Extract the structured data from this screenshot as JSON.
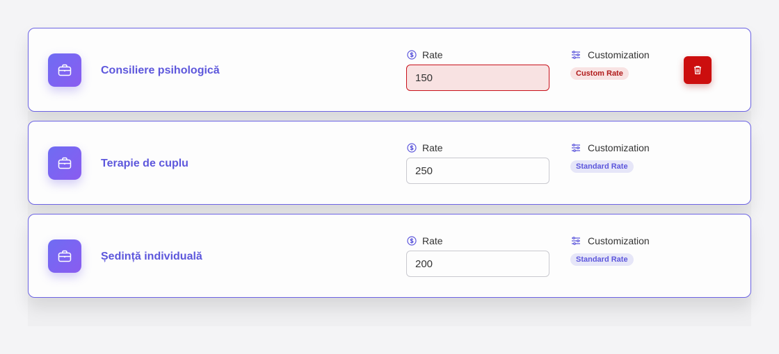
{
  "rate_label": "Rate",
  "customization_label": "Customization",
  "services": [
    {
      "name": "Consiliere psihologică",
      "rate": "150",
      "badge": "Custom Rate"
    },
    {
      "name": "Terapie de cuplu",
      "rate": "250",
      "badge": "Standard Rate"
    },
    {
      "name": "Ședință individuală",
      "rate": "200",
      "badge": "Standard Rate"
    }
  ],
  "colors": {
    "accent": "#5d57dc",
    "danger": "#cc0e0e",
    "card_border": "#6b62e3"
  },
  "icons": {
    "service": "briefcase-icon",
    "rate": "dollar-circle-icon",
    "customization": "sliders-icon",
    "delete": "trash-icon"
  }
}
